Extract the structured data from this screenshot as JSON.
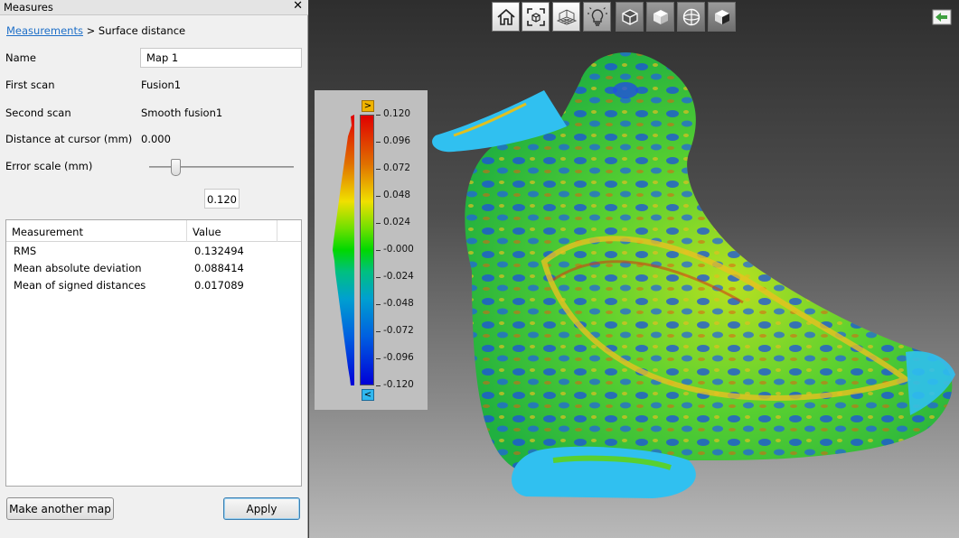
{
  "panel": {
    "title": "Measures",
    "close_glyph": "✕",
    "breadcrumb_link": "Measurements",
    "breadcrumb_rest": " > Surface distance"
  },
  "fields": {
    "name_label": "Name",
    "name_value": "Map 1",
    "first_scan_label": "First scan",
    "first_scan_value": "Fusion1",
    "second_scan_label": "Second scan",
    "second_scan_value": "Smooth fusion1",
    "distance_label": "Distance at cursor (mm)",
    "distance_value": "0.000",
    "error_scale_label": "Error scale (mm)",
    "error_scale_value": "0.120",
    "slider_fraction": 0.19
  },
  "results": {
    "headers": [
      "Measurement",
      "Value"
    ],
    "rows": [
      [
        "RMS",
        "0.132494"
      ],
      [
        "Mean absolute deviation",
        "0.088414"
      ],
      [
        "Mean of signed distances",
        "0.017089"
      ]
    ]
  },
  "buttons": {
    "make_another": "Make another map",
    "apply": "Apply"
  },
  "toolbar": {
    "icons": [
      "home-icon",
      "fit-view-icon",
      "grid-icon",
      "lightbulb-icon",
      "cube-solid-icon",
      "cube-light-icon",
      "sphere-icon",
      "cube-shaded-icon"
    ]
  },
  "color_scale": {
    "up_glyph": ">",
    "down_glyph": "<",
    "labels": [
      "0.120",
      "0.096",
      "0.072",
      "0.048",
      "0.024",
      "-0.000",
      "-0.024",
      "-0.048",
      "-0.072",
      "-0.096",
      "-0.120"
    ]
  },
  "colors": {
    "link": "#1e6fc8",
    "scale_top": "#e00000",
    "scale_mid": "#00d800",
    "scale_bottom": "#0000d8",
    "up_button": "#f0b400",
    "down_button": "#30b8f0"
  }
}
